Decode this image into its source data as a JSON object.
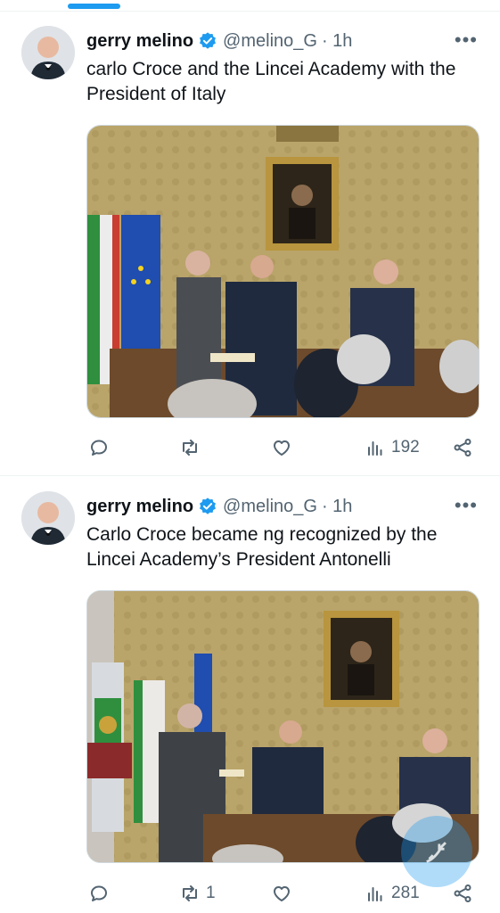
{
  "tweets": [
    {
      "display_name": "gerry melino",
      "handle": "@melino_G",
      "time": "· 1h",
      "text": "carlo Croce and the Lincei Academy with the President of Italy",
      "media_description": "Ceremony photo",
      "actions": {
        "replies": "",
        "retweets": "",
        "likes": "",
        "views": "192"
      }
    },
    {
      "display_name": "gerry melino",
      "handle": "@melino_G",
      "time": "· 1h",
      "text": "Carlo Croce became ng recognized by the Lincei Academy’s President Antonelli",
      "media_description": "Handshake photo",
      "actions": {
        "replies": "",
        "retweets": "1",
        "likes": "",
        "views": "281"
      }
    }
  ],
  "colors": {
    "accent": "#1d9bf0",
    "muted": "#536471",
    "text": "#0f1419",
    "divider": "#eff3f4"
  },
  "icons": [
    "more-icon",
    "verified-icon",
    "reply-icon",
    "retweet-icon",
    "like-icon",
    "views-icon",
    "share-icon",
    "compose-icon"
  ]
}
